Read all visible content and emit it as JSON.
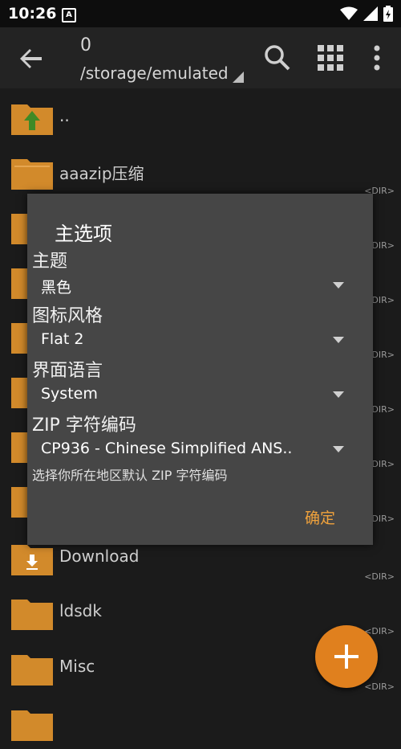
{
  "status_bar": {
    "time": "10:26",
    "notif_glyph": "A",
    "icons": [
      "wifi-icon",
      "signal-icon",
      "battery-icon"
    ]
  },
  "toolbar": {
    "count": "0",
    "path": "/storage/emulated",
    "icons": [
      "back-arrow-icon",
      "search-icon",
      "grid-view-icon",
      "more-vert-icon"
    ]
  },
  "files": [
    {
      "name": "..",
      "type": "parent",
      "dir_tag": ""
    },
    {
      "name": "aaazip压缩",
      "type": "folder",
      "dir_tag": "<DIR>"
    },
    {
      "name": "",
      "type": "folder",
      "dir_tag": "<DIR>"
    },
    {
      "name": "",
      "type": "folder",
      "dir_tag": "<DIR>"
    },
    {
      "name": "",
      "type": "folder",
      "dir_tag": "<DIR>"
    },
    {
      "name": "",
      "type": "folder",
      "dir_tag": "<DIR>"
    },
    {
      "name": "",
      "type": "folder",
      "dir_tag": "<DIR>"
    },
    {
      "name": "",
      "type": "folder",
      "dir_tag": "<DIR>"
    },
    {
      "name": "Download",
      "type": "download",
      "dir_tag": "<DIR>"
    },
    {
      "name": "ldsdk",
      "type": "folder",
      "dir_tag": "<DIR>"
    },
    {
      "name": "Misc",
      "type": "folder",
      "dir_tag": "<DIR>"
    }
  ],
  "dialog": {
    "title": "主选项",
    "theme": {
      "label": "主题",
      "value": "黑色"
    },
    "icon_style": {
      "label": "图标风格",
      "value": "Flat 2"
    },
    "language": {
      "label": "界面语言",
      "value": "System"
    },
    "zip_charset": {
      "label": "ZIP 字符编码",
      "value": "CP936 - Chinese Simplified ANS.."
    },
    "hint": "选择你所在地区默认 ZIP 字符编码",
    "ok_label": "确定"
  },
  "fab": {
    "icon": "plus-icon",
    "color": "#e0801e"
  },
  "colors": {
    "accent": "#f0a23c",
    "folder": "#d28a2b",
    "background": "#1b1b1b"
  }
}
